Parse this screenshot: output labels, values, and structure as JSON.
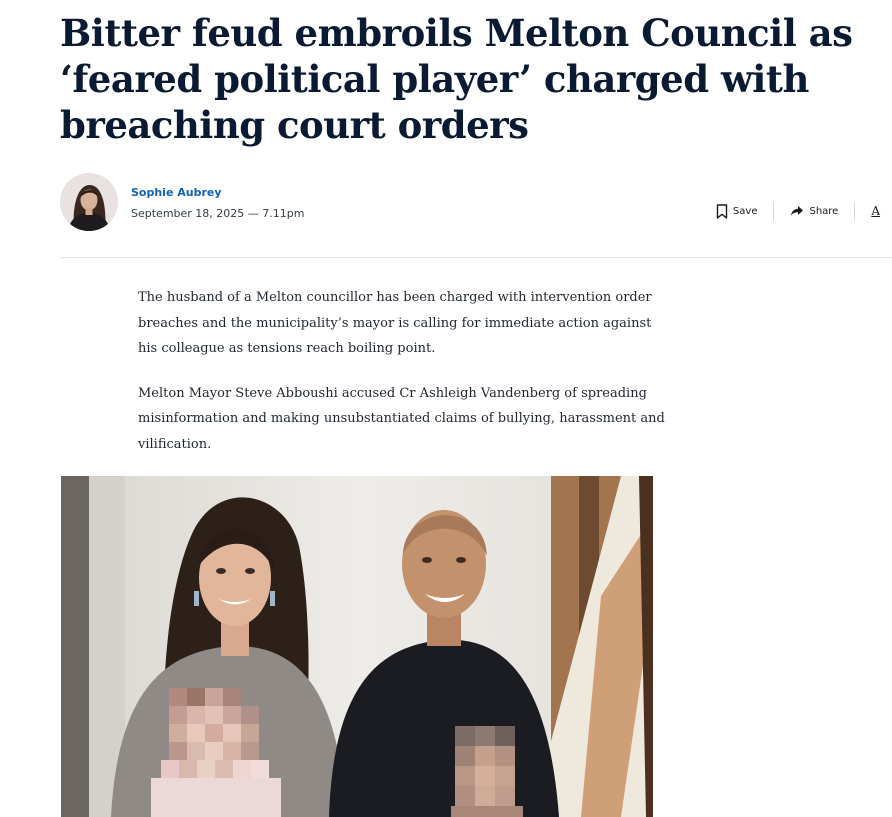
{
  "article": {
    "headline": "Bitter feud embroils Melton Council as ‘feared political player’ charged with breaching court orders",
    "author": {
      "name": "Sophie Aubrey"
    },
    "published": "September 18, 2025 — 7.11pm",
    "tools": {
      "save_label": "Save",
      "share_label": "Share",
      "font_label": "A"
    },
    "paragraphs": [
      "The husband of a Melton councillor has been charged with intervention order breaches and the municipality’s mayor is calling for immediate action against his colleague as tensions reach boiling point.",
      "Melton Mayor Steve Abboushi accused Cr Ashleigh Vandenberg of spreading misinformation and making unsubstantiated claims of bullying, harassment and vilification."
    ]
  },
  "icons": {
    "save": "bookmark-icon",
    "share": "share-arrow-icon"
  },
  "colors": {
    "headline": "#0a1a33",
    "author_link": "#1163b8",
    "divider": "#dfe3e8",
    "body_text": "#1f2530"
  }
}
